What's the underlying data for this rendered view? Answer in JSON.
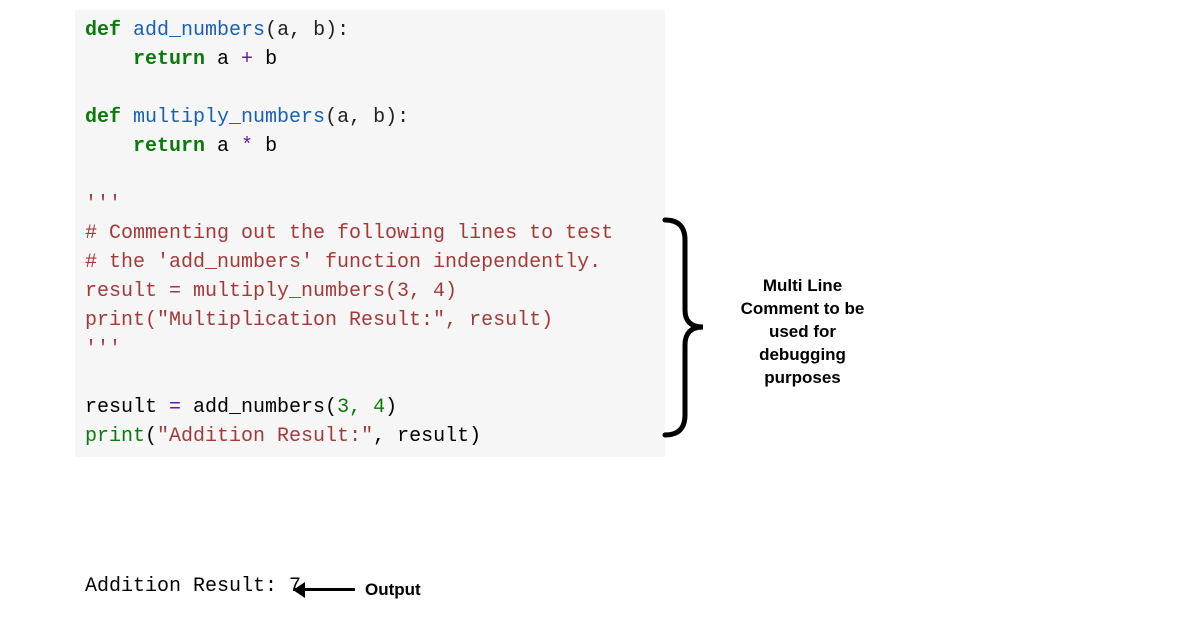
{
  "code": {
    "l1_def": "def",
    "l1_fn": "add_numbers",
    "l1_params": "(a, b):",
    "l2_return": "return",
    "l2_expr": " a ",
    "l2_op": "+",
    "l2_b": " b",
    "l4_def": "def",
    "l4_fn": "multiply_numbers",
    "l4_params": "(a, b):",
    "l5_return": "return",
    "l5_expr": " a ",
    "l5_op": "*",
    "l5_b": " b",
    "l7_triple": "'''",
    "l8_comment": "# Commenting out the following lines to test",
    "l9_comment": "# the 'add_numbers' function independently.",
    "l10_text": "result = multiply_numbers(3, 4)",
    "l11_text": "print(\"Multiplication Result:\", result)",
    "l12_triple": "'''",
    "l14_lhs": "result ",
    "l14_eq": "=",
    "l14_sp": " add_numbers(",
    "l14_args": "3, 4",
    "l14_close": ")",
    "l15_print": "print",
    "l15_open": "(",
    "l15_str": "\"Addition Result:\"",
    "l15_rest": ", result)"
  },
  "output": {
    "text": "Addition Result: 7",
    "label": "Output"
  },
  "annotation": {
    "text": "Multi Line Comment to be used for debugging purposes"
  }
}
